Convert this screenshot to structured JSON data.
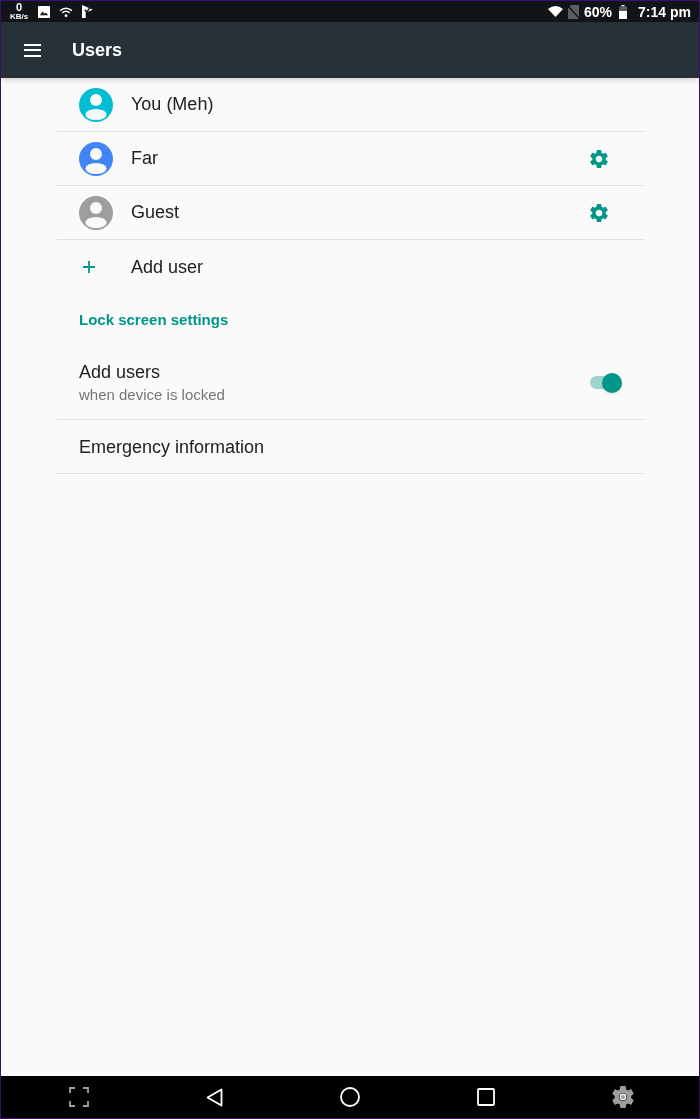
{
  "status_bar": {
    "speed_value": "0",
    "speed_unit": "KB/s",
    "battery_percent": "60%",
    "time": "7:14 pm"
  },
  "toolbar": {
    "title": "Users"
  },
  "users": [
    {
      "name": "You (Meh)",
      "color": "#00bcd4",
      "has_settings": false
    },
    {
      "name": "Far",
      "color": "#4285f4",
      "has_settings": true
    },
    {
      "name": "Guest",
      "color": "#9e9e9e",
      "has_settings": true
    }
  ],
  "add_user": {
    "label": "Add user"
  },
  "lock_screen": {
    "heading": "Lock screen settings",
    "items": [
      {
        "kind": "switch",
        "title": "Add users",
        "summary": "when device is locked",
        "on": true
      },
      {
        "kind": "plain",
        "title": "Emergency information"
      }
    ]
  }
}
